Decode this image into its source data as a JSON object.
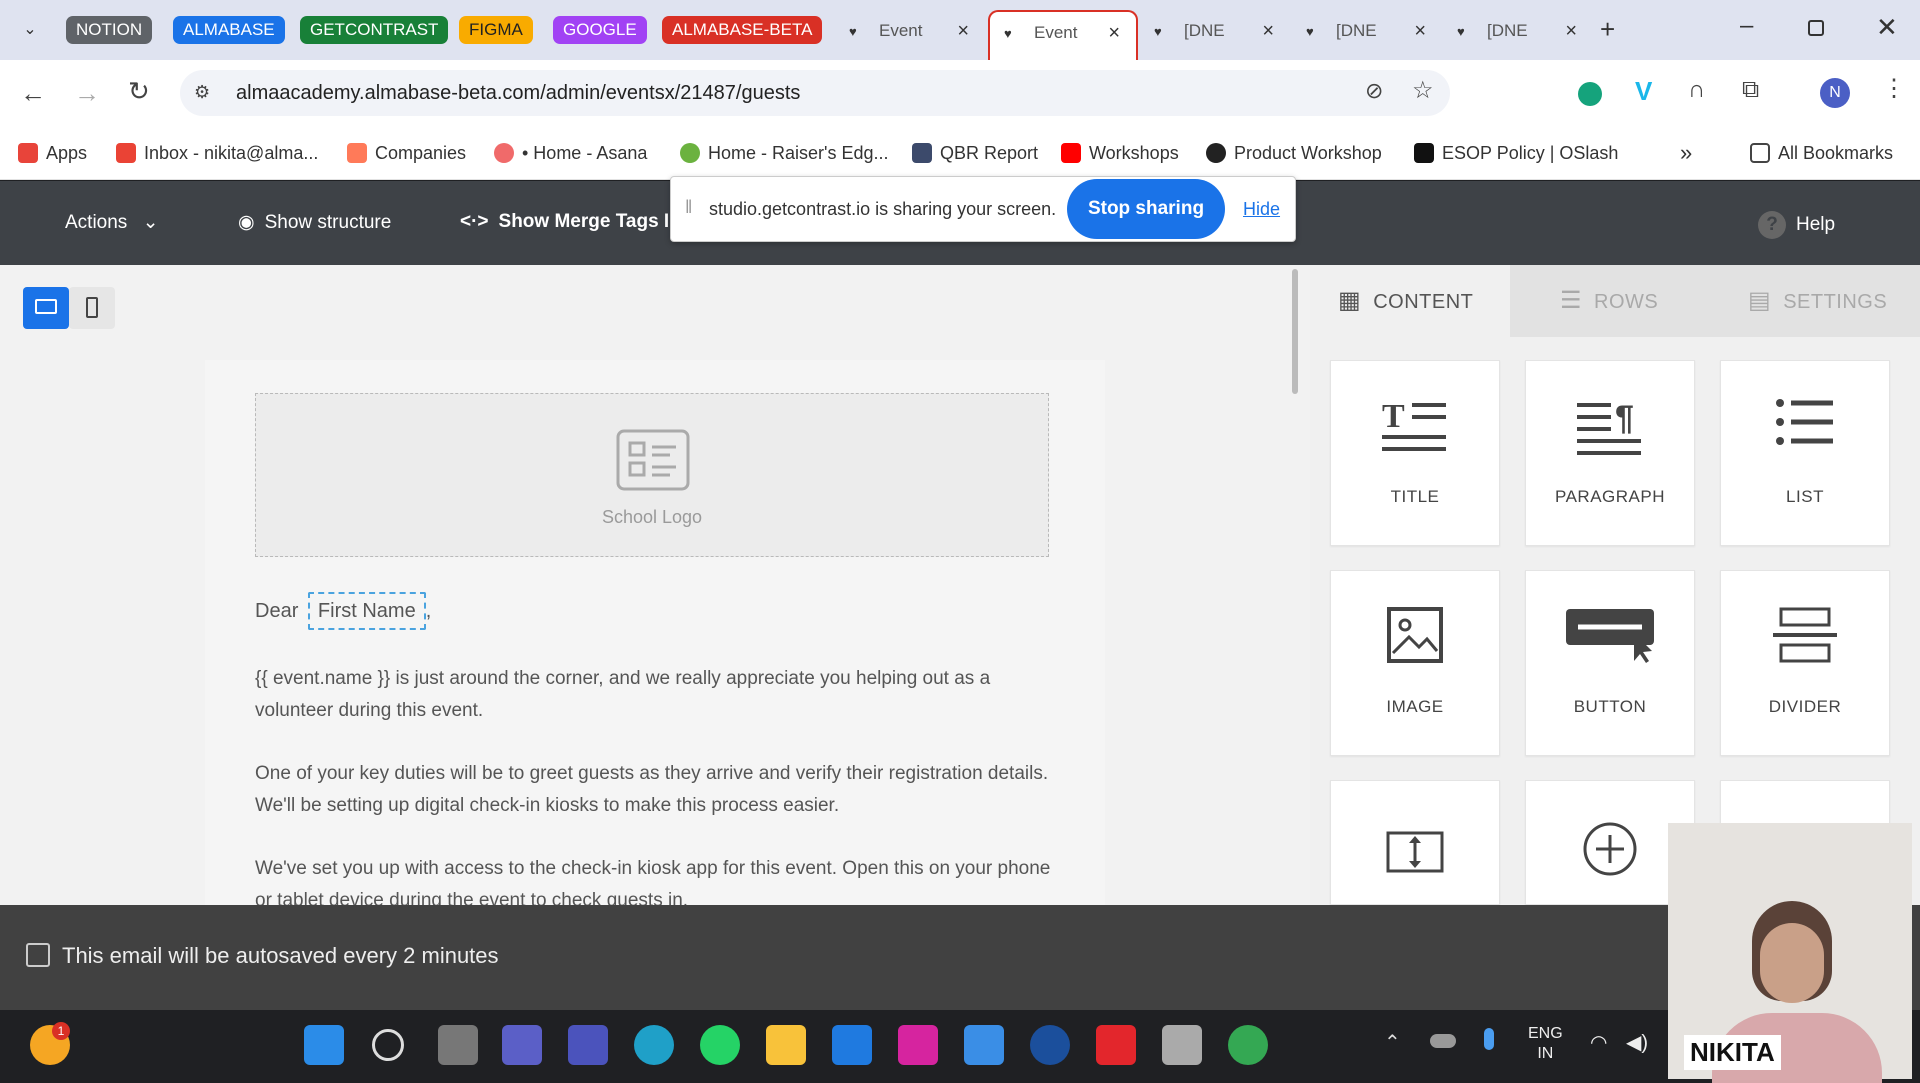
{
  "tab_groups": [
    {
      "label": "NOTION",
      "color": "#5f6368"
    },
    {
      "label": "ALMABASE",
      "color": "#1a73e8"
    },
    {
      "label": "GETCONTRAST",
      "color": "#188038"
    },
    {
      "label": "FIGMA",
      "color": "#f9ab00"
    },
    {
      "label": "GOOGLE",
      "color": "#a142f4"
    },
    {
      "label": "ALMABASE-BETA",
      "color": "#d93025"
    }
  ],
  "tabs": [
    "Event",
    "Event",
    "[DNE",
    "[DNE",
    "[DNE"
  ],
  "url": "almaacademy.almabase-beta.com/admin/eventsx/21487/guests",
  "profile_initial": "N",
  "bookmarks": [
    "Apps",
    "Inbox - nikita@alma...",
    "Companies",
    "• Home - Asana",
    "Home - Raiser's Edg...",
    "QBR Report",
    "Workshops",
    "Product Workshop",
    "ESOP Policy | OSlash"
  ],
  "all_bookmarks": "All Bookmarks",
  "toolbar": {
    "actions": "Actions",
    "show_structure": "Show structure",
    "show_merge_tags": "Show Merge Tags I",
    "help": "Help"
  },
  "share": {
    "text": "studio.getcontrast.io is sharing your screen.",
    "stop": "Stop sharing",
    "hide": "Hide"
  },
  "email": {
    "logo_label": "School Logo",
    "greeting": "Dear",
    "merge_tag": "First Name",
    "comma": ",",
    "p1": "{{ event.name }} is just around the corner, and we really appreciate you helping out as a volunteer during this event.",
    "p2": "One of your key duties will be to greet guests as they arrive and verify their registration details. We'll be setting up digital check-in kiosks to make this process easier.",
    "p3": "We've set you up with access to the check-in kiosk app for this event. Open this on your phone or tablet device during the event to check guests in."
  },
  "panel": {
    "tabs": [
      "CONTENT",
      "ROWS",
      "SETTINGS"
    ],
    "tiles": [
      "TITLE",
      "PARAGRAPH",
      "LIST",
      "IMAGE",
      "BUTTON",
      "DIVIDER"
    ]
  },
  "footer": {
    "autosave": "This email will be autosaved every 2 minutes"
  },
  "taskbar": {
    "lang": "ENG",
    "region": "IN",
    "badge": "1"
  },
  "webcam": {
    "name": "NIKITA"
  }
}
